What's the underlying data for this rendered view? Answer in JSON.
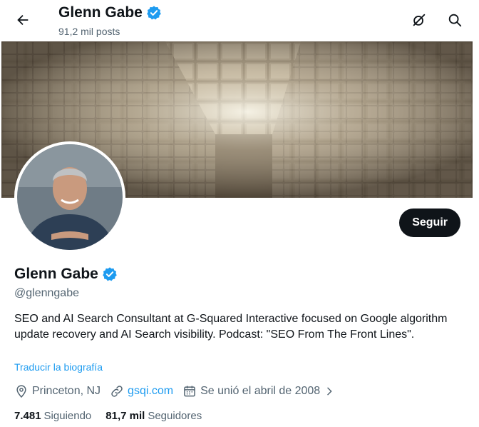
{
  "header": {
    "name": "Glenn Gabe",
    "posts": "91,2 mil posts"
  },
  "profile": {
    "name": "Glenn Gabe",
    "handle": "@glenngabe",
    "bio": "SEO and AI Search Consultant at G-Squared Interactive focused on Google algorithm update recovery and AI Search visibility. Podcast: \"SEO From The Front Lines\".",
    "translate_label": "Traducir la biografía",
    "follow_label": "Seguir",
    "location": "Princeton, NJ",
    "website": "gsqi.com",
    "joined": "Se unió el abril de 2008",
    "following_count": "7.481",
    "following_label": "Siguiendo",
    "followers_count": "81,7 mil",
    "followers_label": "Seguidores"
  },
  "icons": {
    "back": "arrow-left-icon",
    "grok": "grok-icon",
    "search": "search-icon",
    "verified": "verified-badge-icon",
    "location": "location-pin-icon",
    "link": "link-icon",
    "calendar": "calendar-icon",
    "chevron": "chevron-right-icon"
  },
  "colors": {
    "accent": "#1d9bf0",
    "text": "#0f1419",
    "muted": "#536471",
    "button_bg": "#0f1419"
  }
}
